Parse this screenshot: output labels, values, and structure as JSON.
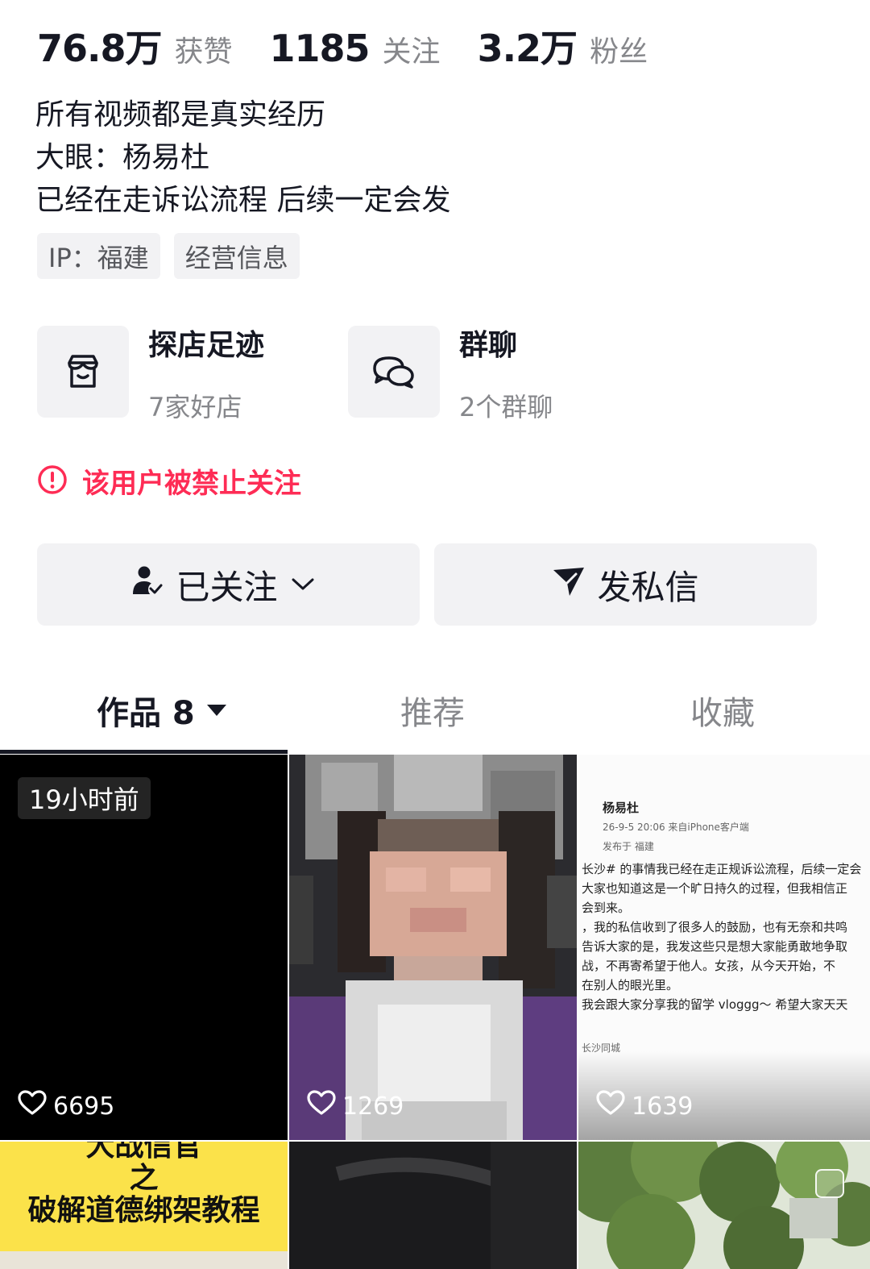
{
  "stats": {
    "likes_value": "76.8万",
    "likes_label": "获赞",
    "following_value": "1185",
    "following_label": "关注",
    "followers_value": "3.2万",
    "followers_label": "粉丝"
  },
  "bio": {
    "line1": "所有视频都是真实经历",
    "line2": "大眼：杨易杜",
    "line3": "已经在走诉讼流程 后续一定会发"
  },
  "tags": {
    "ip": "IP：福建",
    "business": "经营信息"
  },
  "cards": {
    "shop_title": "探店足迹",
    "shop_sub": "7家好店",
    "group_title": "群聊",
    "group_sub": "2个群聊"
  },
  "warning": {
    "text": "该用户被禁止关注"
  },
  "buttons": {
    "follow_label": "已关注",
    "message_label": "发私信"
  },
  "tabs": {
    "works_label": "作品 8",
    "recommend_label": "推荐",
    "favorites_label": "收藏"
  },
  "posts": [
    {
      "badge": "19小时前",
      "likes": "6695"
    },
    {
      "likes": "1269"
    },
    {
      "likes": "1639",
      "author": "杨易杜",
      "meta_line1": "26-9-5 20:06 来自iPhone客户端",
      "meta_line2": "发布于 福建",
      "text_lines": [
        "长沙# 的事情我已经在走正规诉讼流程，后续一定会",
        "大家也知道这是一个旷日持久的过程，但我相信正",
        "会到来。",
        "，我的私信收到了很多人的鼓励，也有无奈和共鸣",
        "告诉大家的是，我发这些只是想大家能勇敢地争取",
        "战，不再寄希望于他人。女孩，从今天开始，不",
        "在别人的眼光里。",
        "我会跟大家分享我的留学 vloggg～ 希望大家天天"
      ],
      "location": "长沙同城"
    },
    {
      "title_line1": "大战信官",
      "title_line2": "之",
      "title_line3": "破解道德绑架教程"
    },
    {},
    {}
  ],
  "colors": {
    "accent_red": "#fe2c55",
    "text_primary": "#161823",
    "text_secondary": "#86878b",
    "chip_bg": "#f2f2f4"
  }
}
